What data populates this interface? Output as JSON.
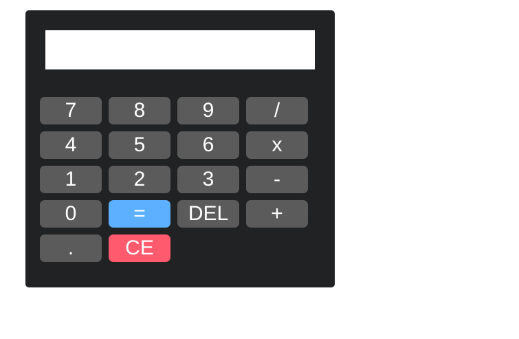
{
  "display": {
    "value": ""
  },
  "keys": [
    {
      "label": "7",
      "name": "key-7",
      "role": "digit"
    },
    {
      "label": "8",
      "name": "key-8",
      "role": "digit"
    },
    {
      "label": "9",
      "name": "key-9",
      "role": "digit"
    },
    {
      "label": "/",
      "name": "key-divide",
      "role": "operator"
    },
    {
      "label": "4",
      "name": "key-4",
      "role": "digit"
    },
    {
      "label": "5",
      "name": "key-5",
      "role": "digit"
    },
    {
      "label": "6",
      "name": "key-6",
      "role": "digit"
    },
    {
      "label": "x",
      "name": "key-multiply",
      "role": "operator"
    },
    {
      "label": "1",
      "name": "key-1",
      "role": "digit"
    },
    {
      "label": "2",
      "name": "key-2",
      "role": "digit"
    },
    {
      "label": "3",
      "name": "key-3",
      "role": "digit"
    },
    {
      "label": "-",
      "name": "key-subtract",
      "role": "operator"
    },
    {
      "label": "0",
      "name": "key-0",
      "role": "digit"
    },
    {
      "label": "=",
      "name": "key-equals",
      "role": "equals"
    },
    {
      "label": "DEL",
      "name": "key-delete",
      "role": "delete"
    },
    {
      "label": "+",
      "name": "key-add",
      "role": "operator"
    },
    {
      "label": ".",
      "name": "key-decimal",
      "role": "digit"
    },
    {
      "label": "CE",
      "name": "key-clear-entry",
      "role": "clear"
    }
  ],
  "colors": {
    "body": "#212224",
    "key": "#5b5b5b",
    "equals": "#5cb0ff",
    "clear": "#ff5a6e",
    "text": "#ffffff"
  }
}
